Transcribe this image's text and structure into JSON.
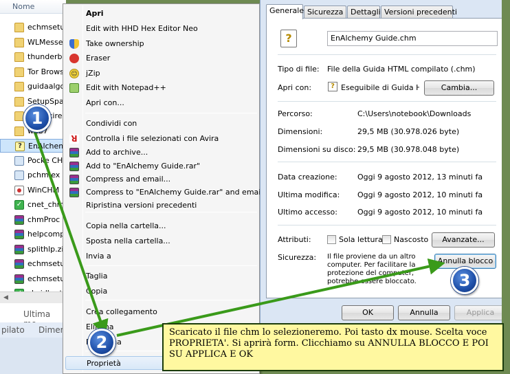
{
  "explorer": {
    "column_header": "Nome",
    "files": [
      {
        "name": "echmsetu",
        "icon": "folder-icon"
      },
      {
        "name": "WLMesse",
        "icon": "folder-icon"
      },
      {
        "name": "thunderb",
        "icon": "folder-icon"
      },
      {
        "name": "Tor Brows",
        "icon": "folder-icon"
      },
      {
        "name": "guidaalgo",
        "icon": "folder-icon"
      },
      {
        "name": "SetupSpa",
        "icon": "folder-icon"
      },
      {
        "name": "Firefoxire",
        "icon": "folder-icon"
      },
      {
        "name": "web7",
        "icon": "folder-icon"
      },
      {
        "name": "EnAlchem",
        "icon": "chm-file-icon",
        "selected": true
      },
      {
        "name": "Pocke CH",
        "icon": "setup-icon"
      },
      {
        "name": "pchm.ex",
        "icon": "setup-icon"
      },
      {
        "name": "WinCHM",
        "icon": "chm-red-icon"
      },
      {
        "name": "cnet_chm",
        "icon": "green-check-icon"
      },
      {
        "name": "chmProc",
        "icon": "rar-icon"
      },
      {
        "name": "helpcomp",
        "icon": "rar-icon"
      },
      {
        "name": "splithlp.zi",
        "icon": "rar-icon"
      },
      {
        "name": "echmsetu",
        "icon": "rar-icon"
      },
      {
        "name": "echmsetu",
        "icon": "rar-icon"
      },
      {
        "name": "cbsidlm-t",
        "icon": "green-check-icon"
      }
    ],
    "details_label_1": "Ultima mo",
    "details_label_2": "pilato",
    "details_label_3": "Dimen"
  },
  "context_menu": {
    "items": [
      {
        "label": "Apri",
        "bold": true,
        "icon": ""
      },
      {
        "label": "Edit with HHD Hex Editor Neo",
        "icon": ""
      },
      {
        "label": "Take ownership",
        "icon": "shield-icon"
      },
      {
        "label": "Eraser",
        "icon": "eraser-icon"
      },
      {
        "label": "jZip",
        "icon": "jzip-icon"
      },
      {
        "label": "Edit with Notepad++",
        "icon": "notepad-icon"
      },
      {
        "label": "Apri con...",
        "icon": ""
      },
      {
        "label": "Condividi con",
        "icon": ""
      },
      {
        "label": "Controlla i file selezionati con Avira",
        "icon": "avira-icon"
      },
      {
        "label": "Add to archive...",
        "icon": "winrar-icon"
      },
      {
        "label": "Add to \"EnAlchemy Guide.rar\"",
        "icon": "winrar-icon"
      },
      {
        "label": "Compress and email...",
        "icon": "winrar-icon"
      },
      {
        "label": "Compress to \"EnAlchemy Guide.rar\" and email",
        "icon": "winrar-icon"
      },
      {
        "label": "Ripristina versioni precedenti",
        "icon": ""
      },
      {
        "label": "Copia nella cartella...",
        "icon": ""
      },
      {
        "label": "Sposta nella cartella...",
        "icon": ""
      },
      {
        "label": "Invia a",
        "icon": ""
      },
      {
        "label": "Taglia",
        "icon": ""
      },
      {
        "label": "Copia",
        "icon": ""
      },
      {
        "label": "Crea collegamento",
        "icon": ""
      },
      {
        "label": "Elimina",
        "icon": ""
      },
      {
        "label": "Rinomina",
        "icon": ""
      },
      {
        "label": "Proprietà",
        "icon": "",
        "hover": true
      }
    ]
  },
  "dialog": {
    "tabs": [
      "Generale",
      "Sicurezza",
      "Dettagli",
      "Versioni precedenti"
    ],
    "file_name": "EnAlchemy Guide.chm",
    "tipo_label": "Tipo di file:",
    "tipo_value": "File della Guida HTML compilato (.chm)",
    "apri_con_label": "Apri con:",
    "apri_con_value": "Eseguibile di Guida HTI",
    "cambia_button": "Cambia...",
    "percorso_label": "Percorso:",
    "percorso_value": "C:\\Users\\notebook\\Downloads",
    "dimensioni_label": "Dimensioni:",
    "dimensioni_value": "29,5 MB (30.978.026 byte)",
    "dimensioni_disco_label": "Dimensioni su disco:",
    "dimensioni_disco_value": "29,5 MB (30.978.048 byte)",
    "data_creazione_label": "Data creazione:",
    "data_creazione_value": "Oggi 9 agosto 2012, 13 minuti fa",
    "ultima_modifica_label": "Ultima modifica:",
    "ultima_modifica_value": "Oggi 9 agosto 2012, 10 minuti fa",
    "ultimo_accesso_label": "Ultimo accesso:",
    "ultimo_accesso_value": "Oggi 9 agosto 2012, 10 minuti fa",
    "attributi_label": "Attributi:",
    "sola_lettura_label": "Sola lettura",
    "nascosto_label": "Nascosto",
    "avanzate_button": "Avanzate...",
    "sicurezza_label": "Sicurezza:",
    "sicurezza_text": "Il file proviene da un altro computer. Per facilitare la protezione del computer, potrebbe essere bloccato.",
    "annulla_blocco_button": "Annulla blocco",
    "ok_button": "OK",
    "annulla_button": "Annulla",
    "applica_button": "Applica"
  },
  "annotations": {
    "badge_1": "1",
    "badge_2": "2",
    "badge_3": "3",
    "note": "Scaricato il file chm lo selezioneremo. Poi tasto dx mouse. Scelta voce PROPRIETA'. Si aprirà form. Clicchiamo su ANNULLA BLOCCO E POI SU APPLICA E OK"
  },
  "colors": {
    "arrow": "#3a9a1a",
    "badge": "#1e4fa8",
    "note_bg": "#fff8a0",
    "frame": "#6e8a52"
  }
}
